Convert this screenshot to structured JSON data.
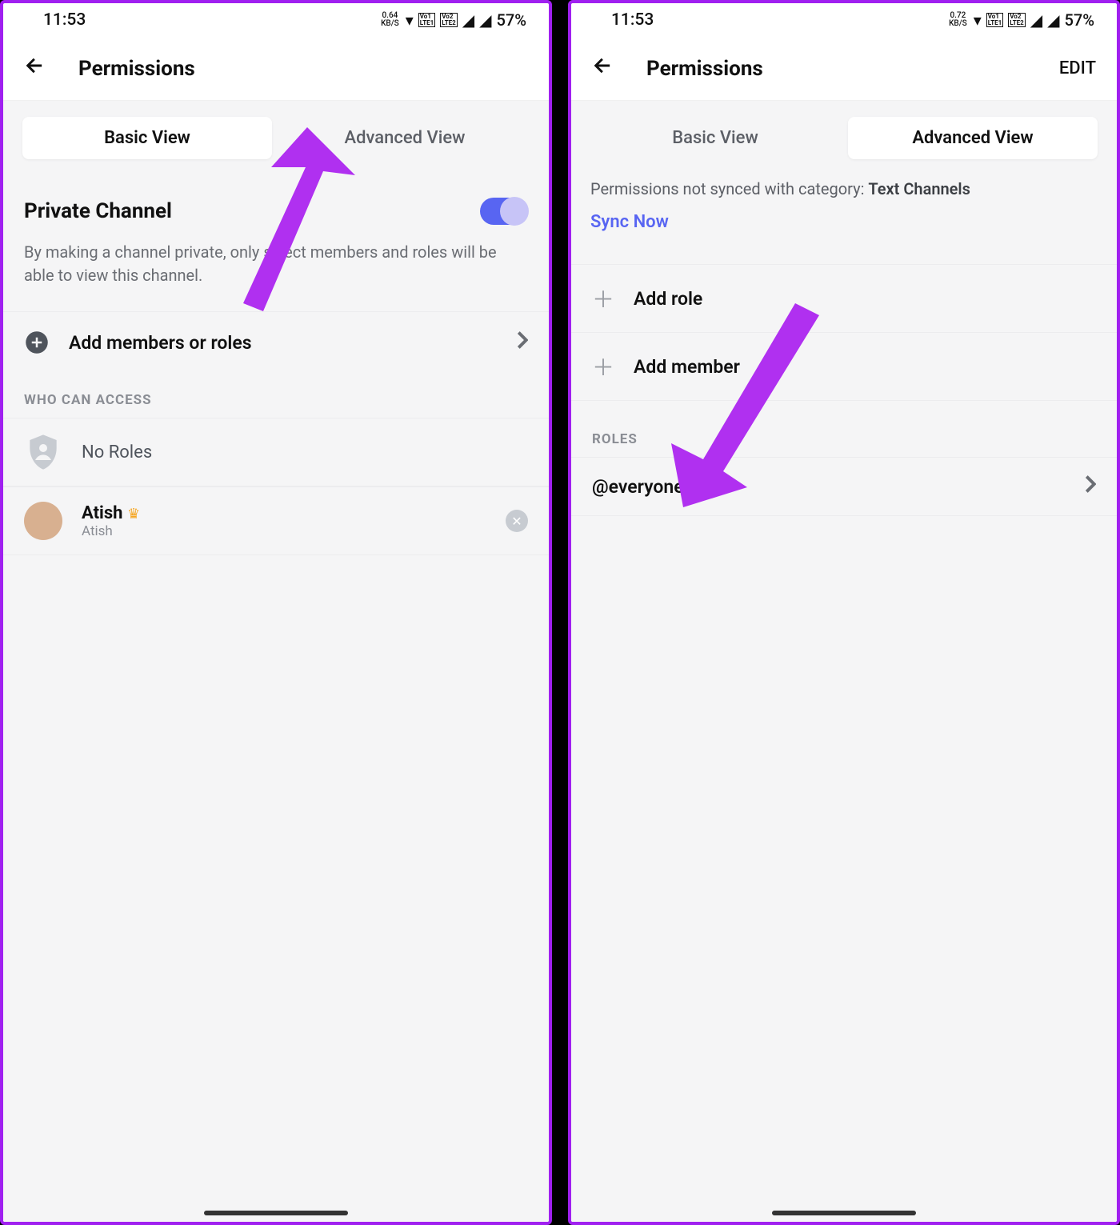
{
  "status": {
    "time": "11:53",
    "kbps_left": "0.64\nKB/S",
    "kbps_right": "0.72\nKB/S",
    "battery": "57%"
  },
  "header": {
    "title": "Permissions",
    "edit": "EDIT"
  },
  "tabs": {
    "basic": "Basic View",
    "advanced": "Advanced View"
  },
  "left": {
    "private_title": "Private Channel",
    "private_desc": "By making a channel private, only select members and roles will be able to view this channel.",
    "add_members": "Add members or roles",
    "who_header": "WHO CAN ACCESS",
    "no_roles": "No Roles",
    "user_name": "Atish",
    "user_sub": "Atish"
  },
  "right": {
    "sync_text": "Permissions not synced with category: ",
    "sync_cat": "Text Channels",
    "sync_now": "Sync Now",
    "add_role": "Add role",
    "add_member": "Add member",
    "roles_header": "ROLES",
    "role_name": "@everyone"
  }
}
